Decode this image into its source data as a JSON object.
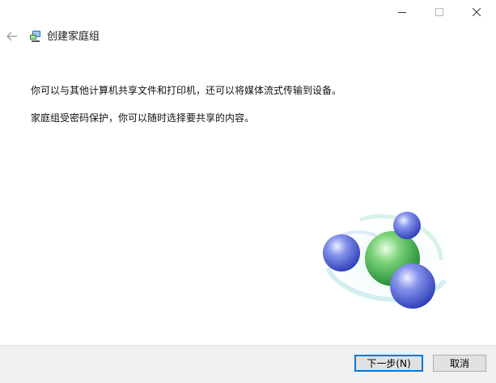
{
  "window": {
    "title": "创建家庭组",
    "controls": {
      "minimize_icon": "minimize-icon",
      "maximize_icon": "maximize-icon",
      "close_icon": "close-icon"
    }
  },
  "header": {
    "back_icon": "back-arrow-icon",
    "app_icon": "homegroup-icon",
    "title": "创建家庭组"
  },
  "content": {
    "line1": "你可以与其他计算机共享文件和打印机，还可以将媒体流式传输到设备。",
    "line2": "家庭组受密码保护，你可以随时选择要共享的内容。"
  },
  "footer": {
    "next_label": "下一步(N)",
    "cancel_label": "取消"
  },
  "colors": {
    "footer_bg": "#f0f0f0",
    "accent": "#0078d7",
    "sphere_green": "#3aa845",
    "sphere_blue": "#4a5fd0"
  }
}
